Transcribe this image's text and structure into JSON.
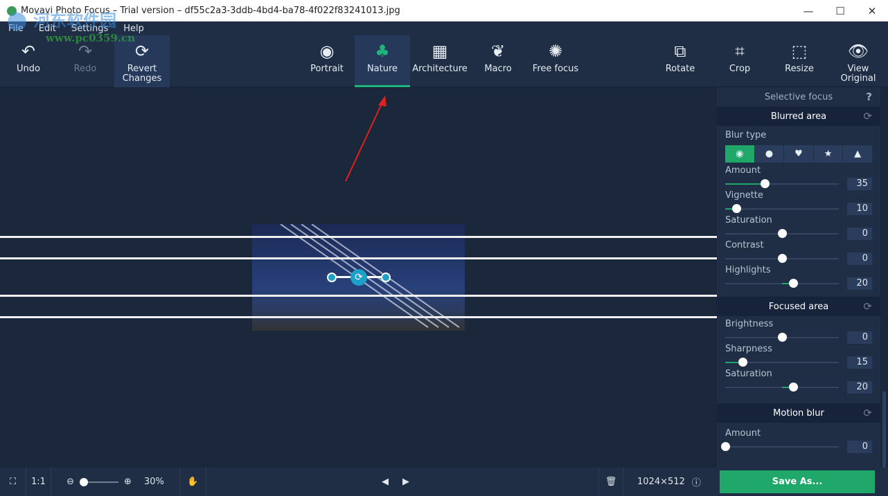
{
  "window": {
    "title": "Movavi Photo Focus – Trial version – df55c2a3-3ddb-4bd4-ba78-4f022f83241013.jpg",
    "minimize": "—",
    "maximize": "☐",
    "close": "✕"
  },
  "watermark": {
    "text": "河东软件园",
    "url": "www.pc0359.cn"
  },
  "menu": [
    "File",
    "Edit",
    "Settings",
    "Help"
  ],
  "toolbar": {
    "undo": "Undo",
    "redo": "Redo",
    "revert": "Revert Changes",
    "modes": [
      {
        "label": "Portrait",
        "icon": "portrait-icon"
      },
      {
        "label": "Nature",
        "icon": "tree-icon",
        "active": true
      },
      {
        "label": "Architecture",
        "icon": "building-icon"
      },
      {
        "label": "Macro",
        "icon": "flower-icon"
      },
      {
        "label": "Free focus",
        "icon": "aperture-icon"
      }
    ],
    "rotate": "Rotate",
    "crop": "Crop",
    "resize": "Resize",
    "view_original": "View Original"
  },
  "panel": {
    "title": "Selective focus",
    "help": "?",
    "blurred": {
      "title": "Blurred area",
      "blur_type_label": "Blur type",
      "blur_types": [
        "circle",
        "bokeh-circle",
        "heart",
        "star",
        "triangle"
      ],
      "selected": 0,
      "sliders": [
        {
          "label": "Amount",
          "value": 35,
          "min": 0,
          "max": 100
        },
        {
          "label": "Vignette",
          "value": 10,
          "min": 0,
          "max": 100
        },
        {
          "label": "Saturation",
          "value": 0,
          "min": -100,
          "max": 100
        },
        {
          "label": "Contrast",
          "value": 0,
          "min": -100,
          "max": 100
        },
        {
          "label": "Highlights",
          "value": 20,
          "min": -100,
          "max": 100
        }
      ]
    },
    "focused": {
      "title": "Focused area",
      "sliders": [
        {
          "label": "Brightness",
          "value": 0,
          "min": -100,
          "max": 100
        },
        {
          "label": "Sharpness",
          "value": 15,
          "min": 0,
          "max": 100
        },
        {
          "label": "Saturation",
          "value": 20,
          "min": -100,
          "max": 100
        }
      ]
    },
    "motion": {
      "title": "Motion blur",
      "sliders": [
        {
          "label": "Amount",
          "value": 0,
          "min": 0,
          "max": 100
        }
      ]
    }
  },
  "status": {
    "fit": "⛶",
    "one_to_one": "1:1",
    "zoom": "30%",
    "zoom_value": 30,
    "dimensions": "1024×512",
    "save": "Save As..."
  },
  "colors": {
    "accent": "#1fa86a",
    "background": "#1b273b",
    "toolbar": "#1f2e45"
  }
}
